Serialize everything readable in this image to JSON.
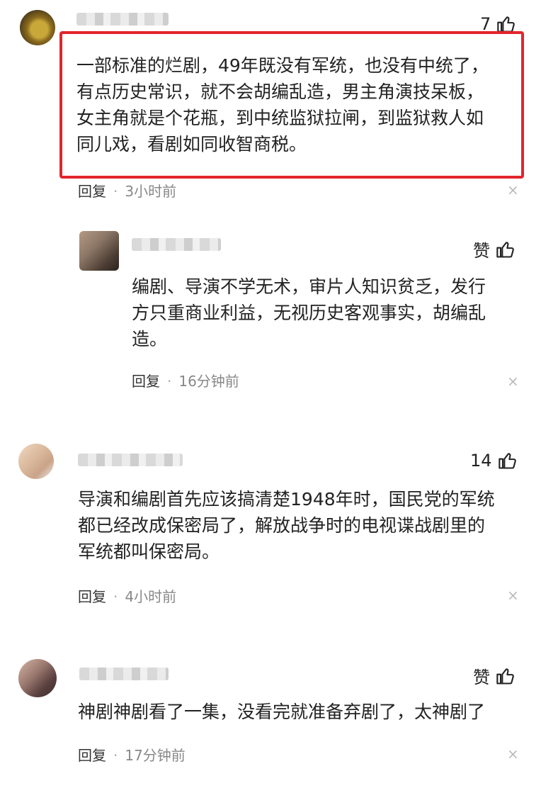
{
  "comments": [
    {
      "likes": "7",
      "text_lines": [
        "一部标准的烂剧，49年既没有军统，也没有中统了，",
        "有点历史常识，就不会胡编乱造，男主角演技呆板，",
        "女主角就是个花瓶，到中统监狱拉闸，到监狱救人如",
        "同儿戏，看剧如同收智商税。"
      ],
      "reply_label": "回复",
      "time": "3小时前"
    },
    {
      "likes": "赞",
      "text_lines": [
        "编剧、导演不学无术，审片人知识贫乏，发行",
        "方只重商业利益，无视历史客观事实，胡编乱",
        "造。"
      ],
      "reply_label": "回复",
      "time": "16分钟前"
    },
    {
      "likes": "14",
      "text_lines": [
        "导演和编剧首先应该搞清楚1948年时，国民党的军统",
        "都已经改成保密局了，解放战争时的电视谍战剧里的",
        "军统都叫保密局。"
      ],
      "reply_label": "回复",
      "time": "4小时前"
    },
    {
      "likes": "赞",
      "text_lines": [
        "神剧神剧看了一集，没看完就准备弃剧了，太神剧了"
      ],
      "reply_label": "回复",
      "time": "17分钟前"
    }
  ],
  "icons": {
    "like": "thumbs-up-icon",
    "close": "close-icon",
    "close_glyph": "×"
  },
  "colors": {
    "highlight": "#e2252c"
  }
}
